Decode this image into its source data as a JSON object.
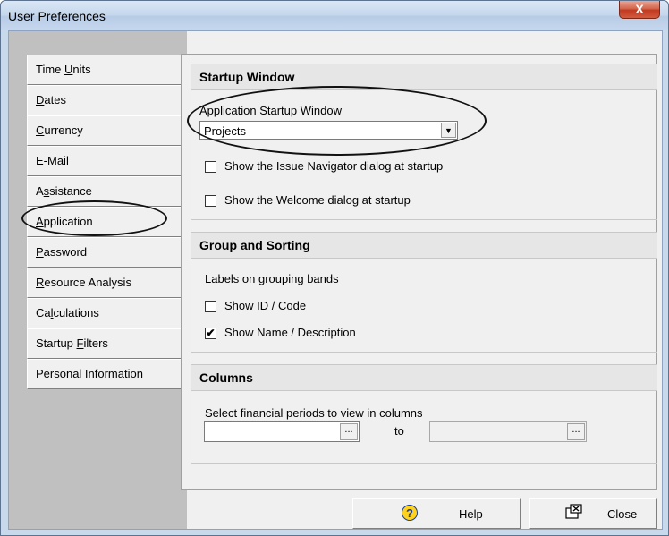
{
  "window": {
    "title": "User Preferences",
    "close_glyph": "X"
  },
  "nav": {
    "items": [
      {
        "pre": "Time ",
        "ul": "U",
        "post": "nits"
      },
      {
        "pre": "",
        "ul": "D",
        "post": "ates"
      },
      {
        "pre": "",
        "ul": "C",
        "post": "urrency"
      },
      {
        "pre": "",
        "ul": "E",
        "post": "-Mail"
      },
      {
        "pre": "A",
        "ul": "s",
        "post": "sistance"
      },
      {
        "pre": "",
        "ul": "A",
        "post": "pplication"
      },
      {
        "pre": "",
        "ul": "P",
        "post": "assword"
      },
      {
        "pre": "",
        "ul": "R",
        "post": "esource Analysis"
      },
      {
        "pre": "Ca",
        "ul": "l",
        "post": "culations"
      },
      {
        "pre": "Startup ",
        "ul": "F",
        "post": "ilters"
      },
      {
        "pre": "Personal Information",
        "ul": "",
        "post": ""
      }
    ],
    "selected": "Application"
  },
  "startup": {
    "header": "Startup Window",
    "combo_label": "Application Startup Window",
    "combo_value": "Projects",
    "checks": [
      {
        "label": "Show the Issue Navigator dialog at startup",
        "checked": false
      },
      {
        "label": "Show the Welcome dialog at startup",
        "checked": false
      }
    ]
  },
  "grouping": {
    "header": "Group and Sorting",
    "subtitle": "Labels on grouping bands",
    "checks": [
      {
        "label": "Show ID / Code",
        "checked": false,
        "mark": ""
      },
      {
        "label": "Show Name / Description",
        "checked": true,
        "mark": "✔"
      }
    ]
  },
  "columns": {
    "header": "Columns",
    "label": "Select financial periods to view in columns",
    "from_value": "",
    "to_label": "to",
    "to_value": "",
    "ellipsis": "..."
  },
  "buttons": {
    "help": "Help",
    "close": "Close"
  },
  "icons": {
    "window_close": "close-x-icon",
    "help": "question-circle-icon",
    "close": "close-window-icon",
    "dropdown": "dropdown-arrow-icon"
  }
}
